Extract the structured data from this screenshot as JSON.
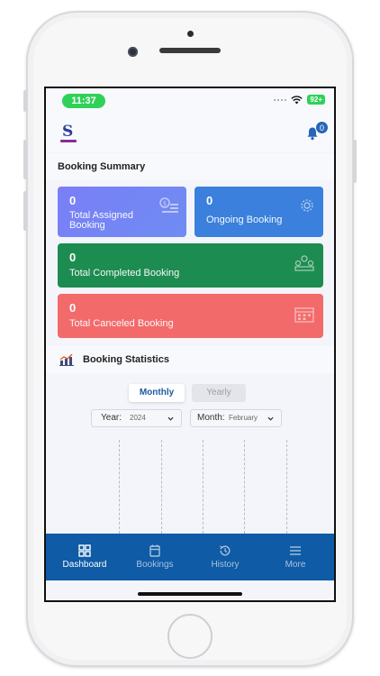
{
  "status_bar": {
    "time": "11:37",
    "battery": "92+"
  },
  "header": {
    "notification_count": "0"
  },
  "booking_summary": {
    "title": "Booking Summary",
    "cards": [
      {
        "count": "0",
        "label_line1": "Total Assigned",
        "label_line2": "Booking",
        "color": "#7b82f8"
      },
      {
        "count": "0",
        "label": "Ongoing Booking",
        "color": "#3a80dc"
      },
      {
        "count": "0",
        "label": "Total Completed Booking",
        "color": "#1d8c50"
      },
      {
        "count": "0",
        "label": "Total Canceled Booking",
        "color": "#f26a6a"
      }
    ]
  },
  "booking_statistics": {
    "title": "Booking Statistics",
    "tabs": [
      {
        "label": "Monthly",
        "active": true
      },
      {
        "label": "Yearly",
        "active": false
      }
    ],
    "year_filter": {
      "label": "Year:",
      "value": "2024"
    },
    "month_filter": {
      "label": "Month:",
      "value": "February"
    }
  },
  "bottom_nav": {
    "items": [
      {
        "label": "Dashboard",
        "icon": "dashboard-icon",
        "active": true
      },
      {
        "label": "Bookings",
        "icon": "bookings-icon",
        "active": false
      },
      {
        "label": "History",
        "icon": "history-icon",
        "active": false
      },
      {
        "label": "More",
        "icon": "menu-icon",
        "active": false
      }
    ],
    "color": "#0f5ba6"
  }
}
